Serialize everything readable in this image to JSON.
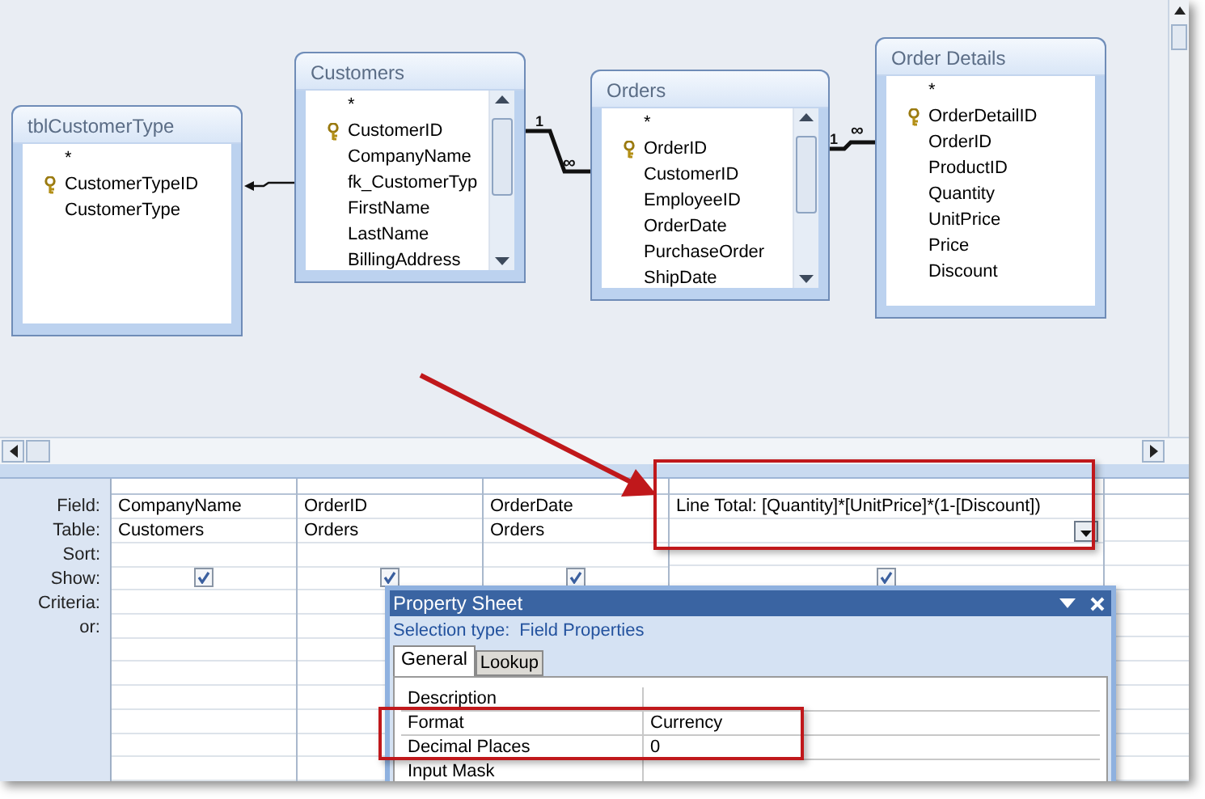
{
  "diagram": {
    "tables": [
      {
        "title": "tblCustomerType",
        "scrollbar": false,
        "fields": [
          {
            "name": "*",
            "primary_key": false
          },
          {
            "name": "CustomerTypeID",
            "primary_key": true
          },
          {
            "name": "CustomerType",
            "primary_key": false
          }
        ]
      },
      {
        "title": "Customers",
        "scrollbar": true,
        "fields": [
          {
            "name": "*",
            "primary_key": false
          },
          {
            "name": "CustomerID",
            "primary_key": true
          },
          {
            "name": "CompanyName",
            "primary_key": false
          },
          {
            "name": "fk_CustomerTyp",
            "primary_key": false
          },
          {
            "name": "FirstName",
            "primary_key": false
          },
          {
            "name": "LastName",
            "primary_key": false
          },
          {
            "name": "BillingAddress",
            "primary_key": false
          }
        ]
      },
      {
        "title": "Orders",
        "scrollbar": true,
        "fields": [
          {
            "name": "*",
            "primary_key": false
          },
          {
            "name": "OrderID",
            "primary_key": true
          },
          {
            "name": "CustomerID",
            "primary_key": false
          },
          {
            "name": "EmployeeID",
            "primary_key": false
          },
          {
            "name": "OrderDate",
            "primary_key": false
          },
          {
            "name": "PurchaseOrder",
            "primary_key": false
          },
          {
            "name": "ShipDate",
            "primary_key": false
          }
        ]
      },
      {
        "title": "Order Details",
        "scrollbar": false,
        "fields": [
          {
            "name": "*",
            "primary_key": false
          },
          {
            "name": "OrderDetailID",
            "primary_key": true
          },
          {
            "name": "OrderID",
            "primary_key": false
          },
          {
            "name": "ProductID",
            "primary_key": false
          },
          {
            "name": "Quantity",
            "primary_key": false
          },
          {
            "name": "UnitPrice",
            "primary_key": false
          },
          {
            "name": "Price",
            "primary_key": false
          },
          {
            "name": "Discount",
            "primary_key": false
          }
        ]
      }
    ],
    "relationships": [
      {
        "kind": "arrow"
      },
      {
        "kind": "one-to-many",
        "one_label": "1",
        "many_label": "∞"
      },
      {
        "kind": "one-to-many",
        "one_label": "1",
        "many_label": "∞"
      }
    ]
  },
  "design_grid": {
    "row_labels": [
      "Field:",
      "Table:",
      "Sort:",
      "Show:",
      "Criteria:",
      "or:"
    ],
    "columns": [
      {
        "field": "CompanyName",
        "table": "Customers",
        "show": true,
        "selected": false
      },
      {
        "field": "OrderID",
        "table": "Orders",
        "show": true,
        "selected": false
      },
      {
        "field": "OrderDate",
        "table": "Orders",
        "show": true,
        "selected": false
      },
      {
        "field": "Line Total: [Quantity]*[UnitPrice]*(1-[Discount])",
        "show": true,
        "selected": true
      }
    ]
  },
  "property_sheet": {
    "title": "Property Sheet",
    "selection_label": "Selection type:",
    "selection_value": "Field Properties",
    "tabs": [
      {
        "label": "General",
        "selected": true
      },
      {
        "label": "Lookup",
        "selected": false
      }
    ],
    "properties": [
      {
        "name": "Description"
      },
      {
        "name": "Format",
        "value": "Currency"
      },
      {
        "name": "Decimal Places",
        "value": "0"
      },
      {
        "name": "Input Mask"
      }
    ]
  }
}
